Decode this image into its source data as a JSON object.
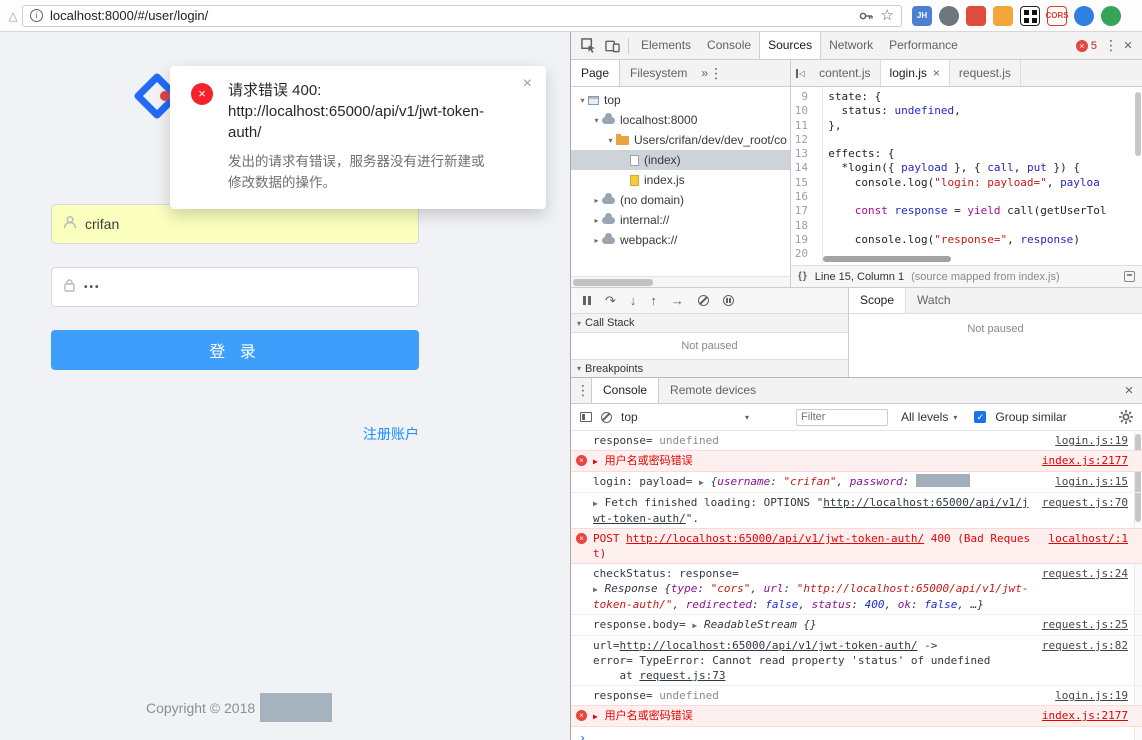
{
  "icons": {
    "window_triangle": "△",
    "info": "i",
    "star": "☆",
    "kebab": "⋮",
    "close": "×",
    "more": "»",
    "arrow_down": "▾",
    "expand": "▶",
    "left_tri": "◁",
    "step_over": "↷",
    "step_into": "↓",
    "step_out": "↑",
    "step": "→",
    "braces": "{}",
    "prompt": "›",
    "dropdown": "▾",
    "check": "✓",
    "error_x": "×"
  },
  "browser": {
    "url": "localhost:8000/#/user/login/",
    "extensions": [
      {
        "name": "extension-jh",
        "label": "JH",
        "bg": "#4d7fd0",
        "fg": "#ffffff",
        "shape": "square"
      },
      {
        "name": "extension-gray-circle",
        "label": "",
        "bg": "#6d767e",
        "fg": "#ffffff",
        "shape": "circle"
      },
      {
        "name": "extension-red",
        "label": "",
        "bg": "#e04a3f",
        "fg": "#ffffff",
        "shape": "square"
      },
      {
        "name": "extension-orange",
        "label": "",
        "bg": "#f0a63a",
        "fg": "#ffffff",
        "shape": "square"
      },
      {
        "name": "extension-qr",
        "label": "",
        "bg": "#ffffff",
        "fg": "#111111",
        "shape": "qr"
      },
      {
        "name": "extension-cors",
        "label": "CORS",
        "bg": "#ffffff",
        "fg": "#e03b2f",
        "shape": "square",
        "border": "#e03b2f"
      },
      {
        "name": "extension-globe",
        "label": "",
        "bg": "#2f7ee0",
        "fg": "#ffffff",
        "shape": "circle"
      },
      {
        "name": "extension-green",
        "label": "",
        "bg": "#35a455",
        "fg": "#ffffff",
        "shape": "circle"
      }
    ]
  },
  "login_page": {
    "popup": {
      "title": "请求错误 400:",
      "url": "http://localhost:65000/api/v1/jwt-token-auth/",
      "description": "发出的请求有错误，服务器没有进行新建或修改数据的操作。"
    },
    "username_value": "crifan",
    "password_value": "•••",
    "login_button": "登 录",
    "register_link": "注册账户",
    "copyright": "Copyright © 2018"
  },
  "devtools": {
    "main_tabs": [
      "Elements",
      "Console",
      "Sources",
      "Network",
      "Performance"
    ],
    "active_main_tab": "Sources",
    "error_badge_count": "5",
    "sources": {
      "nav_tabs": [
        "Page",
        "Filesystem"
      ],
      "active_nav_tab": "Page",
      "tree": [
        {
          "label": "top",
          "level": 0,
          "arrow": "▾",
          "icon": "frame"
        },
        {
          "label": "localhost:8000",
          "level": 1,
          "arrow": "▾",
          "icon": "cloud"
        },
        {
          "label": "Users/crifan/dev/dev_root/co",
          "level": 2,
          "arrow": "▾",
          "icon": "folder"
        },
        {
          "label": "(index)",
          "level": 3,
          "arrow": "",
          "icon": "doc",
          "selected": true
        },
        {
          "label": "index.js",
          "level": 3,
          "arrow": "",
          "icon": "docjs"
        },
        {
          "label": "(no domain)",
          "level": 1,
          "arrow": "▸",
          "icon": "cloud"
        },
        {
          "label": "internal://",
          "level": 1,
          "arrow": "▸",
          "icon": "cloud"
        },
        {
          "label": "webpack://",
          "level": 1,
          "arrow": "▸",
          "icon": "cloud"
        }
      ],
      "editor_tabs": [
        {
          "label": "content.js"
        },
        {
          "label": "login.js",
          "active": true
        },
        {
          "label": "request.js"
        }
      ],
      "code": [
        {
          "n": "9",
          "t": [
            [
              "p",
              "  state: {"
            ]
          ]
        },
        {
          "n": "10",
          "t": [
            [
              "p",
              "    status: "
            ],
            [
              "v",
              "undefined"
            ],
            [
              "p",
              ","
            ]
          ]
        },
        {
          "n": "11",
          "t": [
            [
              "p",
              "  },"
            ]
          ]
        },
        {
          "n": "12",
          "t": [
            [
              "p",
              ""
            ]
          ]
        },
        {
          "n": "13",
          "t": [
            [
              "p",
              "  effects: {"
            ]
          ]
        },
        {
          "n": "14",
          "t": [
            [
              "p",
              "    *login({ "
            ],
            [
              "v",
              "payload"
            ],
            [
              "p",
              " }, { "
            ],
            [
              "v",
              "call"
            ],
            [
              "p",
              ", "
            ],
            [
              "v",
              "put"
            ],
            [
              "p",
              " }) {"
            ]
          ]
        },
        {
          "n": "15",
          "t": [
            [
              "p",
              "      console.log("
            ],
            [
              "s",
              "\"login: payload=\""
            ],
            [
              "p",
              ", "
            ],
            [
              "v",
              "payloa"
            ]
          ]
        },
        {
          "n": "16",
          "t": [
            [
              "p",
              ""
            ]
          ]
        },
        {
          "n": "17",
          "t": [
            [
              "p",
              "      "
            ],
            [
              "k",
              "const"
            ],
            [
              "p",
              " "
            ],
            [
              "v",
              "response"
            ],
            [
              "p",
              " = "
            ],
            [
              "k",
              "yield"
            ],
            [
              "p",
              " call(getUserTol"
            ]
          ]
        },
        {
          "n": "18",
          "t": [
            [
              "p",
              ""
            ]
          ]
        },
        {
          "n": "19",
          "t": [
            [
              "p",
              "      console.log("
            ],
            [
              "s",
              "\"response=\""
            ],
            [
              "p",
              ", "
            ],
            [
              "v",
              "response"
            ],
            [
              "p",
              ")"
            ]
          ]
        },
        {
          "n": "20",
          "t": [
            [
              "p",
              ""
            ]
          ]
        }
      ],
      "status_position": "Line 15, Column 1",
      "status_mapped": "(source mapped from index.js)"
    },
    "debugger": {
      "call_stack_label": "Call Stack",
      "call_stack_empty": "Not paused",
      "breakpoints_label": "Breakpoints",
      "scope_tab": "Scope",
      "watch_tab": "Watch",
      "scope_empty": "Not paused"
    },
    "console": {
      "tabs": [
        "Console",
        "Remote devices"
      ],
      "active_tab": "Console",
      "context": "top",
      "filter_placeholder": "Filter",
      "levels_label": "All levels",
      "group_similar_label": "Group similar",
      "messages": [
        {
          "type": "log",
          "source": "login.js:19",
          "parts": [
            [
              "t",
              "response= "
            ],
            [
              "m",
              "undefined"
            ]
          ]
        },
        {
          "type": "error",
          "source": "index.js:2177",
          "parts": [
            [
              "ae",
              "▶ "
            ],
            [
              "e",
              "用户名或密码错误"
            ]
          ]
        },
        {
          "type": "log",
          "source": "login.js:15",
          "parts": [
            [
              "t",
              "login: payload= "
            ],
            [
              "a",
              "▶ "
            ],
            [
              "i",
              "{"
            ],
            [
              "ik",
              "username"
            ],
            [
              "i",
              ": "
            ],
            [
              "is",
              "\"crifan\""
            ],
            [
              "i",
              ", "
            ],
            [
              "ik",
              "password"
            ],
            [
              "i",
              ": "
            ],
            [
              "r",
              ""
            ]
          ]
        },
        {
          "type": "log",
          "source": "request.js:70",
          "parts": [
            [
              "a",
              "▶ "
            ],
            [
              "t",
              "Fetch finished loading: OPTIONS \""
            ],
            [
              "tu",
              "http://localhost:65000/api/v1/jwt-token-auth/"
            ],
            [
              "t",
              "\"."
            ]
          ]
        },
        {
          "type": "error",
          "source": "localhost/:1",
          "parts": [
            [
              "e",
              "POST "
            ],
            [
              "eu",
              "http://localhost:65000/api/v1/jwt-token-auth/"
            ],
            [
              "e",
              " 400 (Bad Request)"
            ]
          ]
        },
        {
          "type": "log",
          "source": "request.js:24",
          "parts": [
            [
              "t",
              "checkStatus: response="
            ],
            [
              "br",
              ""
            ],
            [
              "a",
              "▶ "
            ],
            [
              "i",
              "Response {"
            ],
            [
              "ik",
              "type"
            ],
            [
              "i",
              ": "
            ],
            [
              "is",
              "\"cors\""
            ],
            [
              "i",
              ", "
            ],
            [
              "ik",
              "url"
            ],
            [
              "i",
              ": "
            ],
            [
              "is",
              "\"http://localhost:65000/api/v1/jwt-token-auth/\""
            ],
            [
              "i",
              ", "
            ],
            [
              "ik",
              "redirected"
            ],
            [
              "i",
              ": "
            ],
            [
              "ib",
              "false"
            ],
            [
              "i",
              ", "
            ],
            [
              "ik",
              "status"
            ],
            [
              "i",
              ": "
            ],
            [
              "ib",
              "400"
            ],
            [
              "i",
              ", "
            ],
            [
              "ik",
              "ok"
            ],
            [
              "i",
              ": "
            ],
            [
              "ib",
              "false"
            ],
            [
              "i",
              ", …}"
            ]
          ]
        },
        {
          "type": "log",
          "source": "request.js:25",
          "parts": [
            [
              "t",
              "response.body= "
            ],
            [
              "a",
              "▶ "
            ],
            [
              "i",
              "ReadableStream {}"
            ]
          ]
        },
        {
          "type": "log",
          "source": "request.js:82",
          "parts": [
            [
              "t",
              "url="
            ],
            [
              "tu",
              "http://localhost:65000/api/v1/jwt-token-auth/"
            ],
            [
              "t",
              " ->"
            ],
            [
              "br",
              ""
            ],
            [
              "t",
              "error= TypeError: Cannot read property 'status' of undefined"
            ],
            [
              "br",
              ""
            ],
            [
              "t",
              "    at "
            ],
            [
              "tu",
              "request.js:73"
            ]
          ]
        },
        {
          "type": "log",
          "source": "login.js:19",
          "parts": [
            [
              "t",
              "response= "
            ],
            [
              "m",
              "undefined"
            ]
          ]
        },
        {
          "type": "error",
          "source": "index.js:2177",
          "parts": [
            [
              "ae",
              "▶ "
            ],
            [
              "e",
              "用户名或密码错误"
            ]
          ]
        },
        {
          "type": "prompt"
        }
      ]
    }
  }
}
